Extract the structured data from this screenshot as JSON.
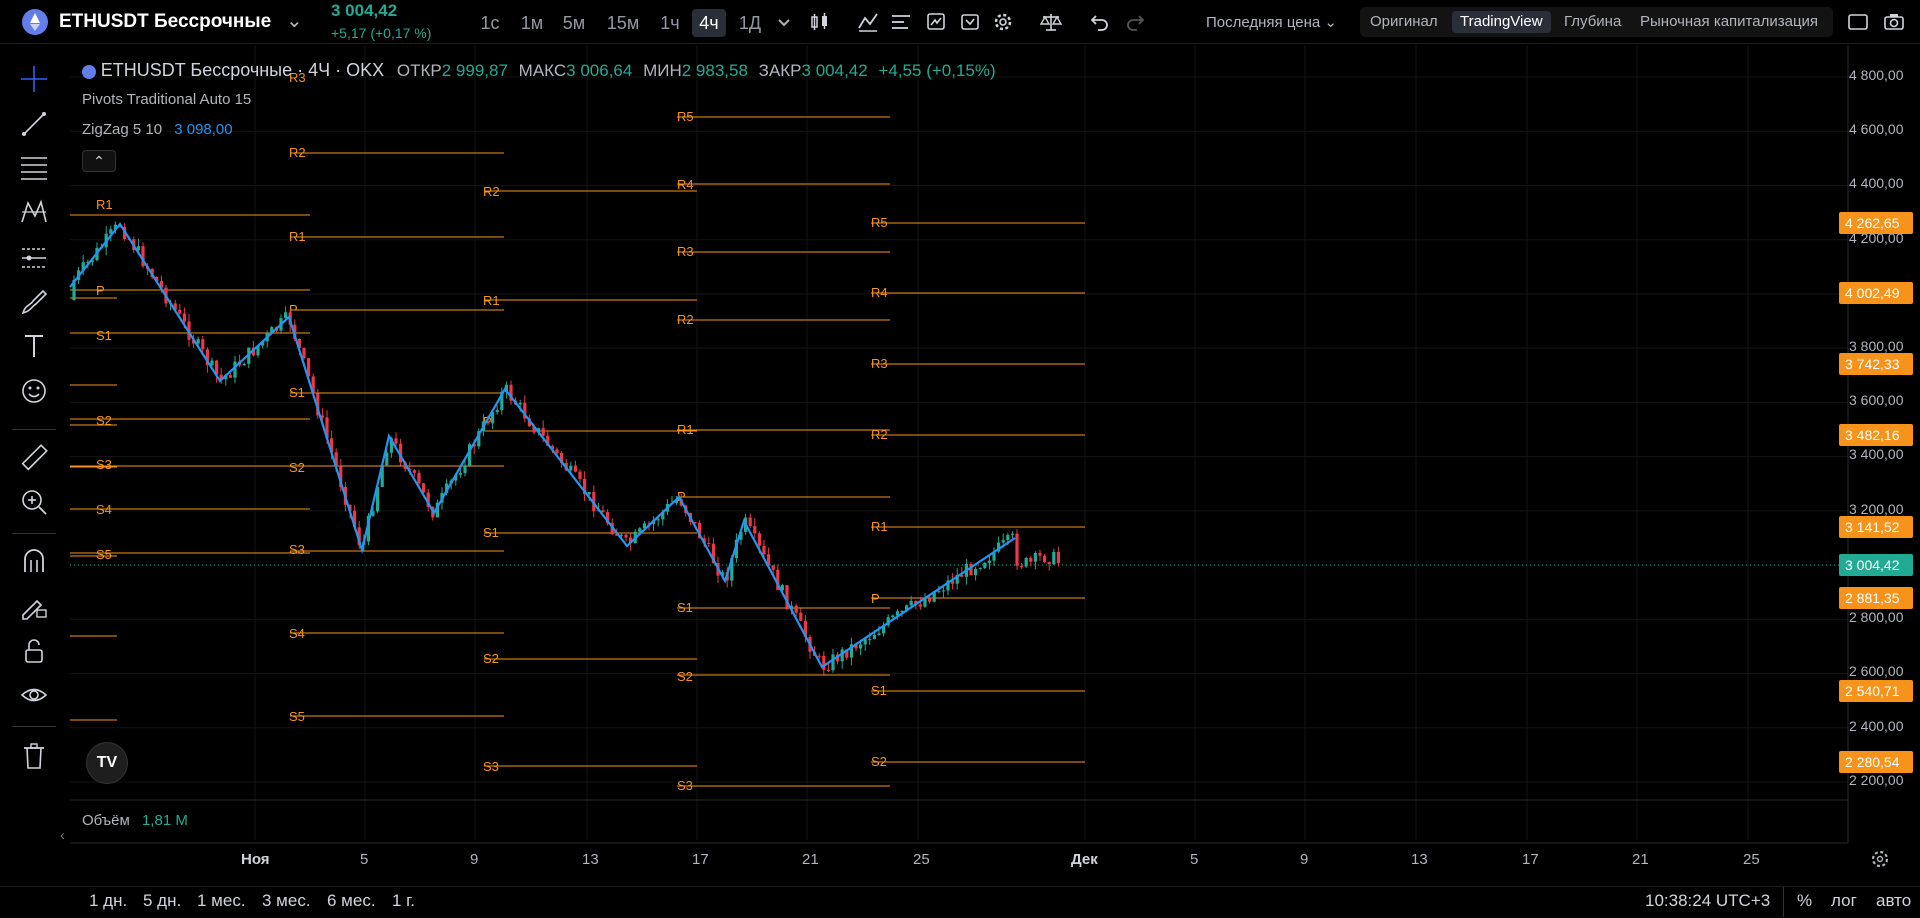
{
  "header": {
    "symbol": "ETHUSDT Бессрочные",
    "price": "3 004,42",
    "change": "+5,17 (+0,17 %)",
    "timeframes": [
      "1с",
      "1м",
      "5м",
      "15м",
      "1ч",
      "4ч",
      "1Д"
    ],
    "active_timeframe": "4ч",
    "price_type": "Последняя цена",
    "views": [
      "Оригинал",
      "TradingView",
      "Глубина",
      "Рыночная капитализация"
    ],
    "active_view": "TradingView"
  },
  "legend": {
    "title": "ETHUSDT Бессрочные · 4Ч · OKX",
    "open_label": "ОТКР",
    "open": "2 999,87",
    "high_label": "МАКС",
    "high": "3 006,64",
    "low_label": "МИН",
    "low": "2 983,58",
    "close_label": "ЗАКР",
    "close": "3 004,42",
    "change": "+4,55 (+0,15%)",
    "indicator1": "Pivots Traditional Auto 15",
    "indicator2": "ZigZag 5 10",
    "indicator2_value": "3 098,00",
    "volume_label": "Объём",
    "volume_value": "1,81 M"
  },
  "price_axis": [
    "4 800,00",
    "4 600,00",
    "4 400,00",
    "4 200,00",
    "3 800,00",
    "3 600,00",
    "3 400,00",
    "3 200,00",
    "2 800,00",
    "2 600,00",
    "2 400,00",
    "2 200,00"
  ],
  "price_tags": [
    {
      "text": "4 262,65",
      "color": "#f7931a"
    },
    {
      "text": "4 002,49",
      "color": "#f7931a"
    },
    {
      "text": "3 742,33",
      "color": "#f7931a"
    },
    {
      "text": "3 482,16",
      "color": "#f7931a"
    },
    {
      "text": "3 141,52",
      "color": "#f7931a"
    },
    {
      "text": "3 004,42",
      "color": "#22ab94"
    },
    {
      "text": "2 881,35",
      "color": "#f7931a"
    },
    {
      "text": "2 540,71",
      "color": "#f7931a"
    },
    {
      "text": "2 280,54",
      "color": "#f7931a"
    }
  ],
  "date_axis": [
    "Ноя",
    "5",
    "9",
    "13",
    "17",
    "21",
    "25",
    "Дек",
    "5",
    "9",
    "13",
    "17",
    "21",
    "25"
  ],
  "ranges": [
    "1 дн.",
    "5 дн.",
    "1 мес.",
    "3 мес.",
    "6 мес.",
    "1 г."
  ],
  "clock": "10:38:24 UTC+3",
  "scale_options": [
    "%",
    "лог",
    "авто"
  ],
  "pivot_labels": [
    "R1",
    "P",
    "S1",
    "S2",
    "S3",
    "S4",
    "S5",
    "R3",
    "R2",
    "R1",
    "P",
    "S1",
    "S2",
    "S3",
    "S4",
    "S5",
    "R2",
    "R1",
    "P",
    "S1",
    "S2",
    "S3",
    "R5",
    "R4",
    "R3",
    "R2",
    "R1",
    "P",
    "S1",
    "S2",
    "S3",
    "R5",
    "R4",
    "R3",
    "R2",
    "R1",
    "P",
    "S1",
    "S2"
  ],
  "colors": {
    "up": "#22ab94",
    "down": "#f23645",
    "pivot": "#f7931a",
    "zigzag": "#2196f3"
  }
}
